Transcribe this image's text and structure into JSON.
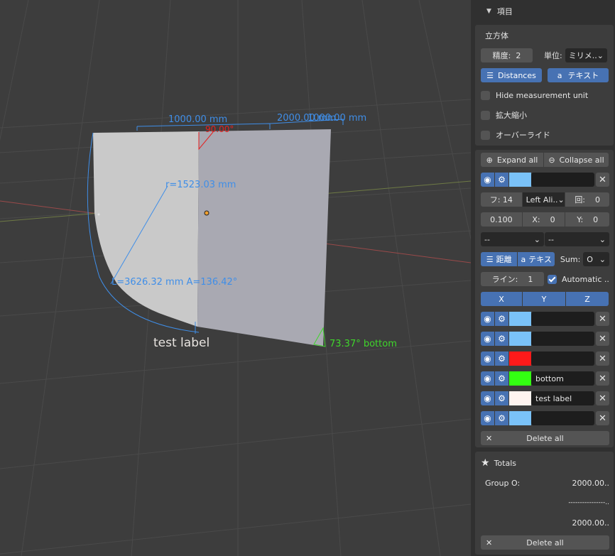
{
  "viewport": {
    "dim_top_left": "1000.00 mm",
    "dim_top_right_a": "2000.00 mm",
    "dim_top_right_b": "1000.00 mm",
    "angle_red": "90.00°",
    "radius": "r=1523.03 mm",
    "arc": "L=3626.32 mm A=136.42°",
    "custom_label": "test label",
    "angle_green": "73.37° bottom",
    "colors": {
      "blue": "#3f8ee8",
      "red": "#e52020",
      "green": "#3fd62b",
      "grid": "#4a4a4a",
      "mesh_light": "#c9c9c9",
      "mesh_dark": "#a8a8b0"
    }
  },
  "sidebar": {
    "section_title": "項目",
    "object_name": "立方体",
    "precision_label": "精度:",
    "precision_value": "2",
    "unit_label": "単位:",
    "unit_value": "ミリメ..",
    "distances_btn": "Distances",
    "text_btn": "テキスト",
    "hide_unit_label": "Hide measurement unit",
    "scale_label": "拡大縮小",
    "override_label": "オーバーライド",
    "expand_all": "Expand all",
    "collapse_all": "Collapse all",
    "font_label": "フ: 14",
    "align_value": "Left Ali..",
    "rotation_label": "回:",
    "rotation_value": "0",
    "offset_value": "0.100",
    "x_label": "X:",
    "x_value": "0",
    "y_label": "Y:",
    "y_value": "0",
    "dropdown1": "--",
    "dropdown2": "--",
    "distance_btn": "距離",
    "text_btn2": "テキス",
    "sum_label": "Sum:",
    "sum_value": "O",
    "line_label": "ライン:",
    "line_value": "1",
    "automatic_label": "Automatic ..",
    "axis_x": "X",
    "axis_y": "Y",
    "axis_z": "Z",
    "items": [
      {
        "color": "#7ac2f8",
        "text": ""
      },
      {
        "color": "#7ac2f8",
        "text": ""
      },
      {
        "color": "#ff1a1a",
        "text": ""
      },
      {
        "color": "#33ff12",
        "text": "bottom"
      },
      {
        "color": "#fff4f0",
        "text": "test label"
      },
      {
        "color": "#7ac2f8",
        "text": ""
      }
    ],
    "first_item_color": "#7ac2f8",
    "delete_all": "Delete all",
    "totals_title": "Totals",
    "group_label": "Group O:",
    "group_value": "2000.00..",
    "separator_value": "----------------..",
    "total_value": "2000.00..",
    "delete_all_2": "Delete all"
  }
}
